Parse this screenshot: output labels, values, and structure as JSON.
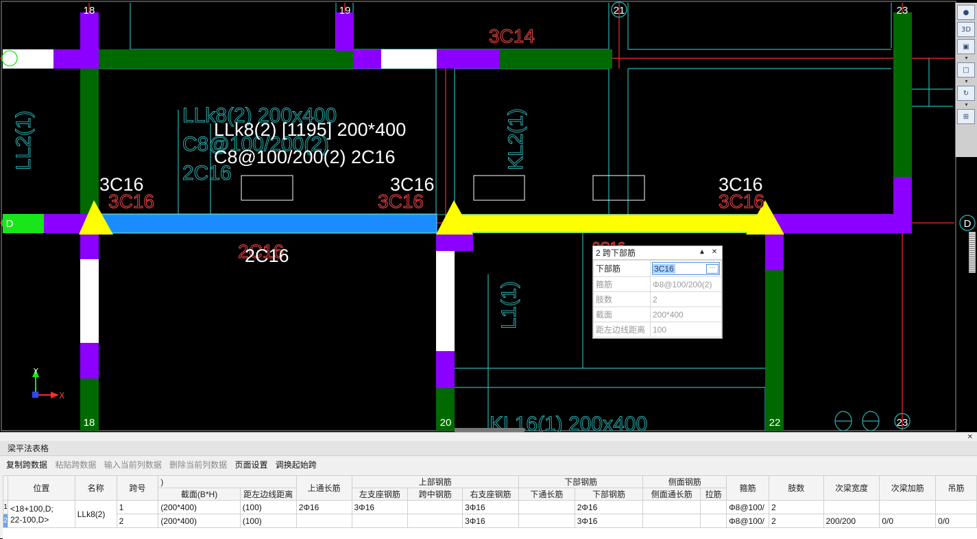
{
  "cad": {
    "axis_labels_top": [
      "18",
      "19",
      "21",
      "23"
    ],
    "axis_labels_bottom": [
      "18",
      "20",
      "22",
      "23"
    ],
    "axis_d_left": "D",
    "axis_d_right": "D",
    "beam_label_main": "LLk8(2) [1195] 200*400",
    "beam_label_stirrup": "C8@100/200(2) 2C16",
    "cyan_label_1": "LLk8(2) 200x400",
    "cyan_label_2": "C8@100/200(2)",
    "cyan_label_3": "2C16",
    "top_red_label": "3C14",
    "support_white_left": "3C16",
    "support_white_mid": "3C16",
    "support_white_right": "3C16",
    "support_red_left": "3C16",
    "support_red_mid": "3C16",
    "support_red_right": "3C16",
    "bottom_white_label": "2C16",
    "bottom_red_label": "2C16",
    "ll2": "LL2(1)",
    "kl2": "KL2(1)",
    "l1": "L1(1)",
    "kl16": "KL16(1) 200x400",
    "red_partial_right": "2C16",
    "axis_y": "Y",
    "axis_x": "X",
    "colors": {
      "green": "#006a00",
      "purple": "#8c00ff",
      "yellow": "#ffff00",
      "blue": "#1a8cff",
      "cyan": "#2ab5b5",
      "red": "#ff3a3a"
    }
  },
  "view_toolbar": {
    "btn_3d": "3D",
    "btn_rotate_icon": "rotate-icon"
  },
  "property_panel": {
    "title": "2 跨下部筋",
    "rows": [
      {
        "key": "下部筋",
        "value": "3C16",
        "active": true
      },
      {
        "key": "箍筋",
        "value": "Φ8@100/200(2)"
      },
      {
        "key": "肢数",
        "value": "2"
      },
      {
        "key": "截面",
        "value": "200*400"
      },
      {
        "key": "距左边线距离",
        "value": "100"
      }
    ]
  },
  "bottom_panel": {
    "title": "梁平法表格",
    "toolbar": [
      {
        "label": "复制跨数据",
        "enabled": true
      },
      {
        "label": "粘贴跨数据",
        "enabled": false
      },
      {
        "label": "输入当前列数据",
        "enabled": false
      },
      {
        "label": "删除当前列数据",
        "enabled": false
      },
      {
        "label": "页面设置",
        "enabled": true
      },
      {
        "label": "调换起始跨",
        "enabled": true
      }
    ],
    "headers": {
      "position": "位置",
      "name": "名称",
      "span": "跨号",
      "fragment": ")",
      "section": "截面(B*H)",
      "offset": "距左边线距离",
      "top_through": "上通长筋",
      "top_group": "上部钢筋",
      "left_support": "左支座钢筋",
      "mid_span": "跨中钢筋",
      "right_support": "右支座钢筋",
      "bottom_group": "下部钢筋",
      "bottom_through": "下通长筋",
      "bottom_bars": "下部钢筋",
      "side_group": "侧面钢筋",
      "side_through": "侧面通长筋",
      "tie": "拉筋",
      "stirrup": "箍筋",
      "legs": "肢数",
      "sub_width": "次梁宽度",
      "sub_add": "次梁加筋",
      "hanger": "吊筋"
    },
    "position_value": "<18+100,D;\n22-100,D>",
    "name_value": "LLk8(2)",
    "rows": [
      {
        "rn": "1",
        "span": "1",
        "section": "(200*400)",
        "offset": "(100)",
        "top_through": "2Φ16",
        "left_support": "3Φ16",
        "mid_span": "",
        "right_support": "3Φ16",
        "bottom_through": "",
        "bottom_bars": "2Φ16",
        "side_through": "",
        "tie": "",
        "stirrup": "Φ8@100/",
        "legs": "2",
        "sub_width": "",
        "sub_add": "",
        "hanger": ""
      },
      {
        "rn": "2",
        "span": "2",
        "section": "(200*400)",
        "offset": "(100)",
        "top_through": "",
        "left_support": "",
        "mid_span": "",
        "right_support": "3Φ16",
        "bottom_through": "",
        "bottom_bars": "3Φ16",
        "side_through": "",
        "tie": "",
        "stirrup": "Φ8@100/",
        "legs": "2",
        "sub_width": "200/200",
        "sub_add": "0/0",
        "hanger": "0/0"
      }
    ]
  }
}
